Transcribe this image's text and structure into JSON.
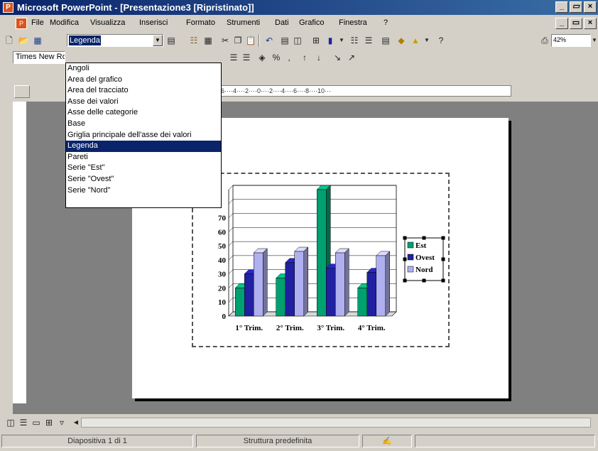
{
  "window": {
    "title": "Microsoft PowerPoint - [Presentazione3 [Ripristinato]]",
    "app_icon_letter": "P",
    "controls": [
      "_",
      "×"
    ]
  },
  "menu": {
    "items": [
      "File",
      "Modifica",
      "Visualizza",
      "Inserisci",
      "Formato",
      "Strumenti",
      "Dati",
      "Grafico",
      "Finestra",
      "?"
    ]
  },
  "toolbar": {
    "element_selector": "Legenda",
    "font_name": "Times New Roman",
    "zoom": "42%"
  },
  "dropdown": {
    "items": [
      "Angoli",
      "Area del grafico",
      "Area del tracciato",
      "Asse dei valori",
      "Asse delle categorie",
      "Base",
      "Griglia principale dell'asse dei valori",
      "Legenda",
      "Pareti",
      "Serie \"Est\"",
      "Serie \"Ovest\"",
      "Serie \"Nord\""
    ],
    "selected_index": 7
  },
  "ruler": {
    "labels": "6····4····2····0····2····4····6····8····10···"
  },
  "chart_data": {
    "type": "bar",
    "categories": [
      "1° Trim.",
      "2° Trim.",
      "3° Trim.",
      "4° Trim."
    ],
    "series": [
      {
        "name": "Est",
        "values": [
          20,
          27,
          90,
          20
        ],
        "color": "#00a070"
      },
      {
        "name": "Ovest",
        "values": [
          30,
          38,
          34,
          31
        ],
        "color": "#2020a0"
      },
      {
        "name": "Nord",
        "values": [
          45,
          46,
          45,
          43
        ],
        "color": "#b0b0f0"
      }
    ],
    "ylim": [
      0,
      90
    ],
    "yticks": [
      0,
      10,
      20,
      30,
      40,
      50,
      60,
      70
    ],
    "grid": true,
    "legend": "right"
  },
  "status": {
    "slide": "Diapositiva 1 di 1",
    "design": "Struttura predefinita"
  },
  "colors": {
    "title_bar": "#0a246a",
    "selection": "#0a246a",
    "chrome": "#d4d0c8"
  }
}
